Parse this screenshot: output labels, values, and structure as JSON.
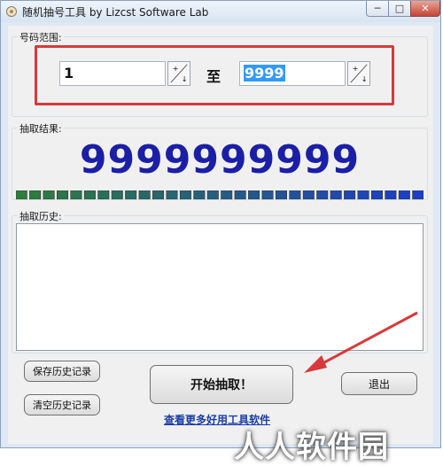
{
  "window": {
    "title": "随机抽号工具    by Lizcst Software Lab",
    "min_glyph": "─",
    "max_glyph": "□",
    "close_glyph": "✕"
  },
  "range": {
    "label": "号码范围:",
    "from_value": "1",
    "separator": "至",
    "to_value": "9999"
  },
  "result": {
    "label": "抽取结果:",
    "number": "9999999999",
    "led_count": 30,
    "led_start_color": "#2e7d3c",
    "led_end_color": "#1c3ec8"
  },
  "history": {
    "label": "抽取历史:"
  },
  "buttons": {
    "save_history": "保存历史记录",
    "clear_history": "清空历史记录",
    "start": "开始抽取！",
    "exit": "退出"
  },
  "link": {
    "more_tools": "查看更多好用工具软件"
  },
  "watermark": {
    "text": "人人软件园"
  },
  "colors": {
    "highlight_box": "#d73a3a",
    "arrow": "#d73a3a",
    "result_digits": "#1b1fa6"
  },
  "icons": {
    "app": "app-icon",
    "spinner": "spinner-icon",
    "arrow": "red-arrow-annotation"
  }
}
